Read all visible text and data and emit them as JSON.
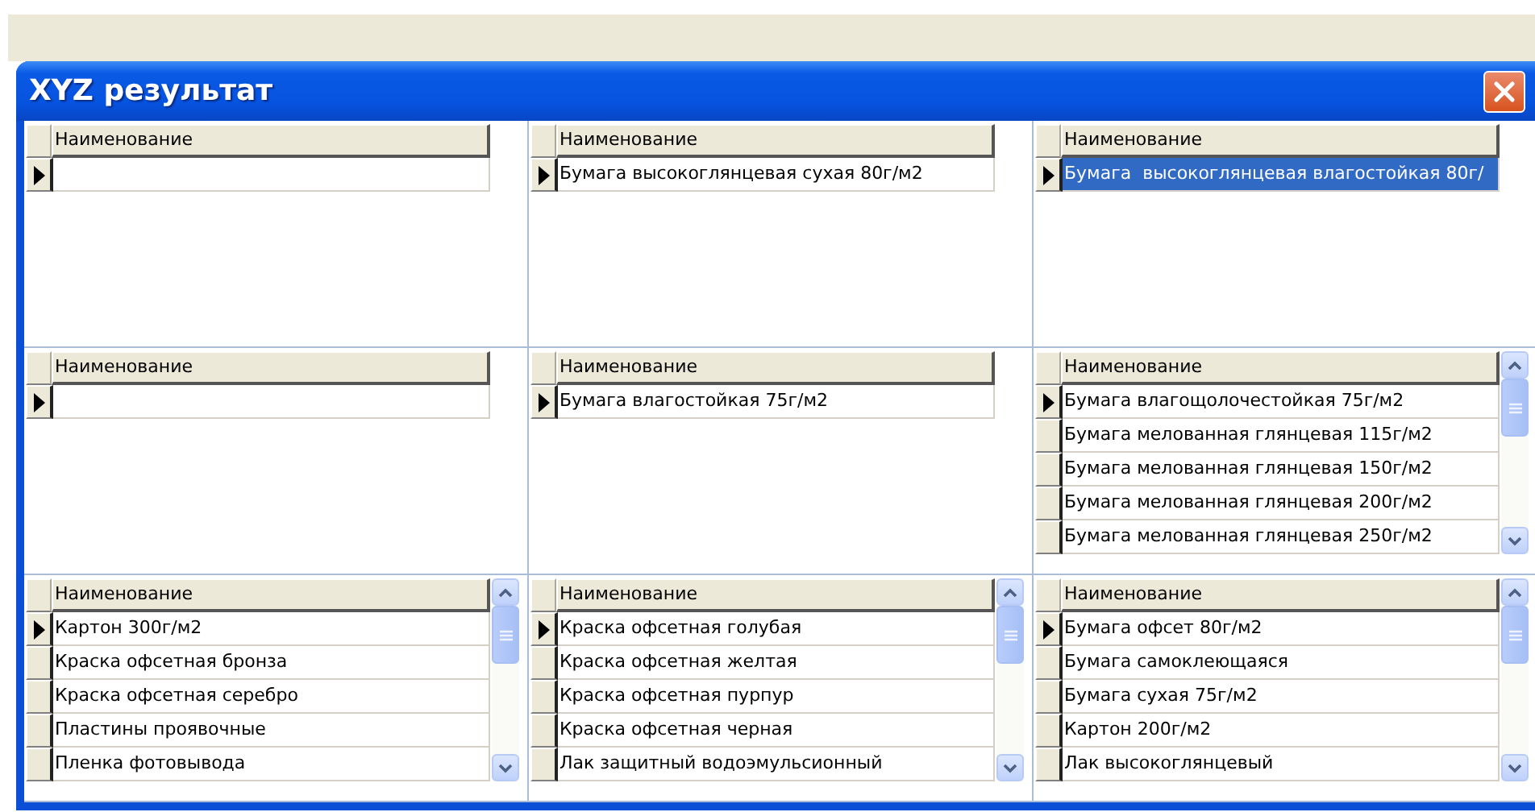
{
  "window": {
    "title": "XYZ результат"
  },
  "panels": [
    {
      "column_header": "Наименование",
      "scrollbar": false,
      "rows": [
        {
          "current": true,
          "selected": false
        }
      ]
    },
    {
      "column_header": "Наименование",
      "scrollbar": false,
      "rows": [
        {
          "text": "Бумага высокоглянцевая сухая 80г/м2",
          "current": true,
          "selected": false
        }
      ]
    },
    {
      "column_header": "Наименование",
      "scrollbar": false,
      "rows": [
        {
          "text": "Бумага  высокоглянцевая влагостойкая 80г/",
          "current": true,
          "selected": true
        }
      ]
    },
    {
      "column_header": "Наименование",
      "scrollbar": false,
      "rows": [
        {
          "current": true,
          "selected": false
        }
      ]
    },
    {
      "column_header": "Наименование",
      "scrollbar": false,
      "rows": [
        {
          "text": "Бумага влагостойкая 75г/м2",
          "current": true,
          "selected": false
        }
      ]
    },
    {
      "column_header": "Наименование",
      "scrollbar": true,
      "rows": [
        {
          "text": "Бумага влагощолочестойкая 75г/м2",
          "current": true,
          "selected": false
        },
        {
          "text": "Бумага мелованная глянцевая 115г/м2",
          "current": false,
          "selected": false
        },
        {
          "text": "Бумага мелованная глянцевая 150г/м2",
          "current": false,
          "selected": false
        },
        {
          "text": "Бумага мелованная глянцевая 200г/м2",
          "current": false,
          "selected": false
        },
        {
          "text": "Бумага мелованная глянцевая 250г/м2",
          "current": false,
          "selected": false
        }
      ]
    },
    {
      "column_header": "Наименование",
      "scrollbar": true,
      "rows": [
        {
          "text": "Картон 300г/м2",
          "current": true,
          "selected": false
        },
        {
          "text": "Краска офсетная бронза",
          "current": false,
          "selected": false
        },
        {
          "text": "Краска офсетная серебро",
          "current": false,
          "selected": false
        },
        {
          "text": "Пластины проявочные",
          "current": false,
          "selected": false
        },
        {
          "text": "Пленка фотовывода",
          "current": false,
          "selected": false
        }
      ]
    },
    {
      "column_header": "Наименование",
      "scrollbar": true,
      "rows": [
        {
          "text": "Краска офсетная голубая",
          "current": true,
          "selected": false
        },
        {
          "text": "Краска офсетная желтая",
          "current": false,
          "selected": false
        },
        {
          "text": "Краска офсетная пурпур",
          "current": false,
          "selected": false
        },
        {
          "text": "Краска офсетная черная",
          "current": false,
          "selected": false
        },
        {
          "text": "Лак защитный водоэмульсионный",
          "current": false,
          "selected": false
        }
      ]
    },
    {
      "column_header": "Наименование",
      "scrollbar": true,
      "rows": [
        {
          "text": "Бумага офсет 80г/м2",
          "current": true,
          "selected": false
        },
        {
          "text": "Бумага самоклеющаяся",
          "current": false,
          "selected": false
        },
        {
          "text": "Бумага сухая 75г/м2",
          "current": false,
          "selected": false
        },
        {
          "text": "Картон 200г/м2",
          "current": false,
          "selected": false
        },
        {
          "text": "Лак высокоглянцевый",
          "current": false,
          "selected": false
        }
      ]
    }
  ]
}
